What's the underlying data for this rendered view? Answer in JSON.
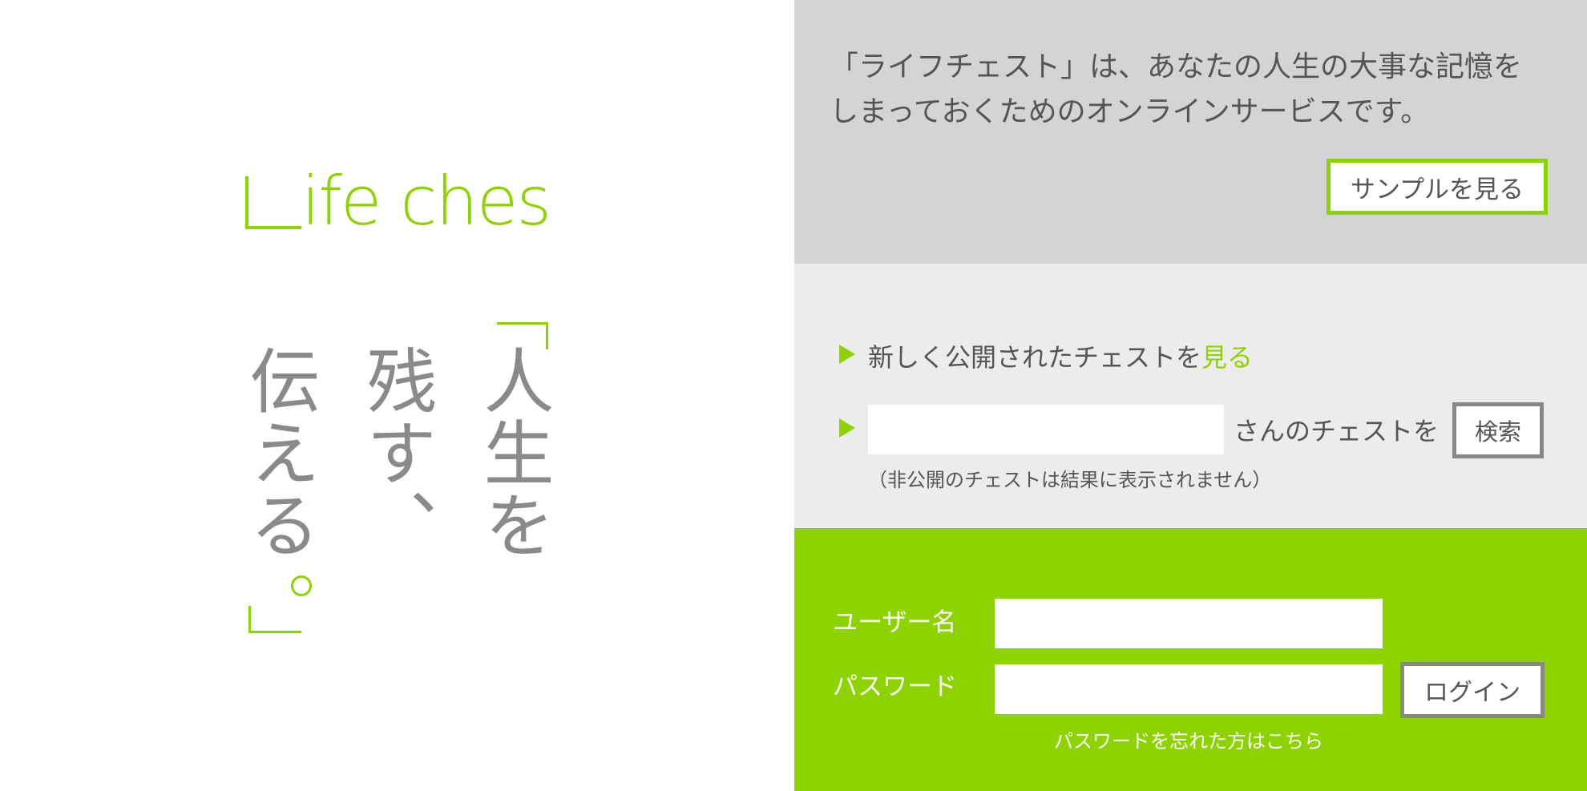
{
  "logo": {
    "text": "Life chest",
    "color": "#8dd300"
  },
  "tagline": {
    "col1": "人生を",
    "col2": "残す、",
    "col3": "伝える",
    "text_color": "#8a8a8a",
    "accent_color": "#8dd300"
  },
  "intro": {
    "line1": "「ライフチェスト」は、あなたの人生の大事な記憶を",
    "line2": "しまっておくためのオンラインサービスです。",
    "sample_button": "サンプルを見る"
  },
  "search": {
    "new_chest_text": "新しく公開されたチェストを",
    "new_chest_link": "見る",
    "input_value": "",
    "suffix": "さんのチェストを",
    "button": "検索",
    "note": "（非公開のチェストは結果に表示されません）"
  },
  "login": {
    "username_label": "ユーザー名",
    "password_label": "パスワード",
    "username_value": "",
    "password_value": "",
    "button": "ログイン",
    "forgot_link": "パスワードを忘れた方はこちら"
  },
  "colors": {
    "accent": "#8dd300",
    "intro_bg": "#d4d4d4",
    "search_bg": "#ececec",
    "login_bg": "#8dd300"
  }
}
